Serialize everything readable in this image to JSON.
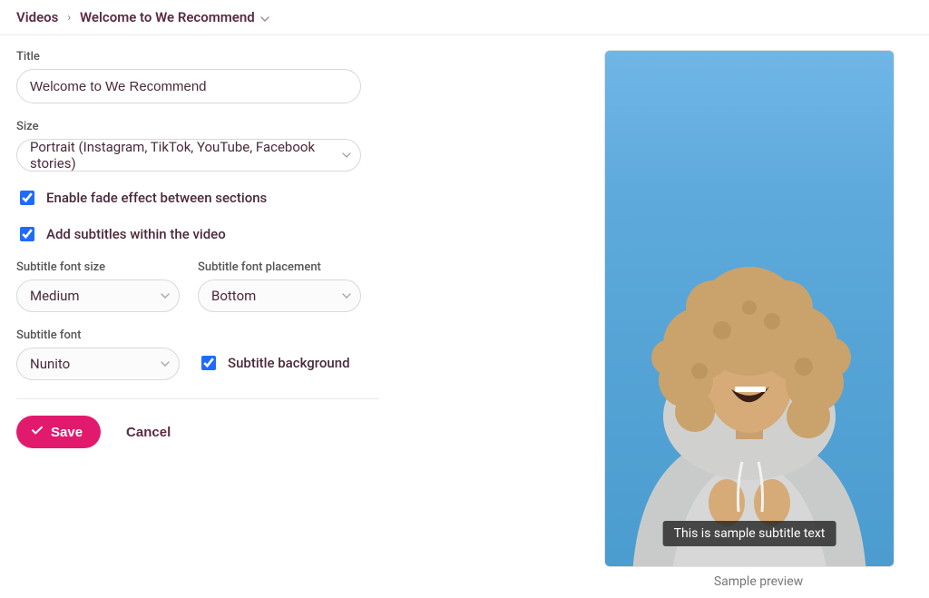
{
  "breadcrumb": {
    "root": "Videos",
    "current": "Welcome to We Recommend"
  },
  "form": {
    "title_label": "Title",
    "title_value": "Welcome to We Recommend",
    "size_label": "Size",
    "size_value": "Portrait (Instagram, TikTok, YouTube, Facebook stories)",
    "enable_fade_label": "Enable fade effect between sections",
    "enable_fade_checked": true,
    "add_subtitles_label": "Add subtitles within the video",
    "add_subtitles_checked": true,
    "subtitle_font_size_label": "Subtitle font size",
    "subtitle_font_size_value": "Medium",
    "subtitle_font_placement_label": "Subtitle font placement",
    "subtitle_font_placement_value": "Bottom",
    "subtitle_font_label": "Subtitle font",
    "subtitle_font_value": "Nunito",
    "subtitle_background_label": "Subtitle background",
    "subtitle_background_checked": true,
    "save_label": "Save",
    "cancel_label": "Cancel"
  },
  "preview": {
    "subtitle_text": "This is sample subtitle text",
    "caption": "Sample preview"
  }
}
